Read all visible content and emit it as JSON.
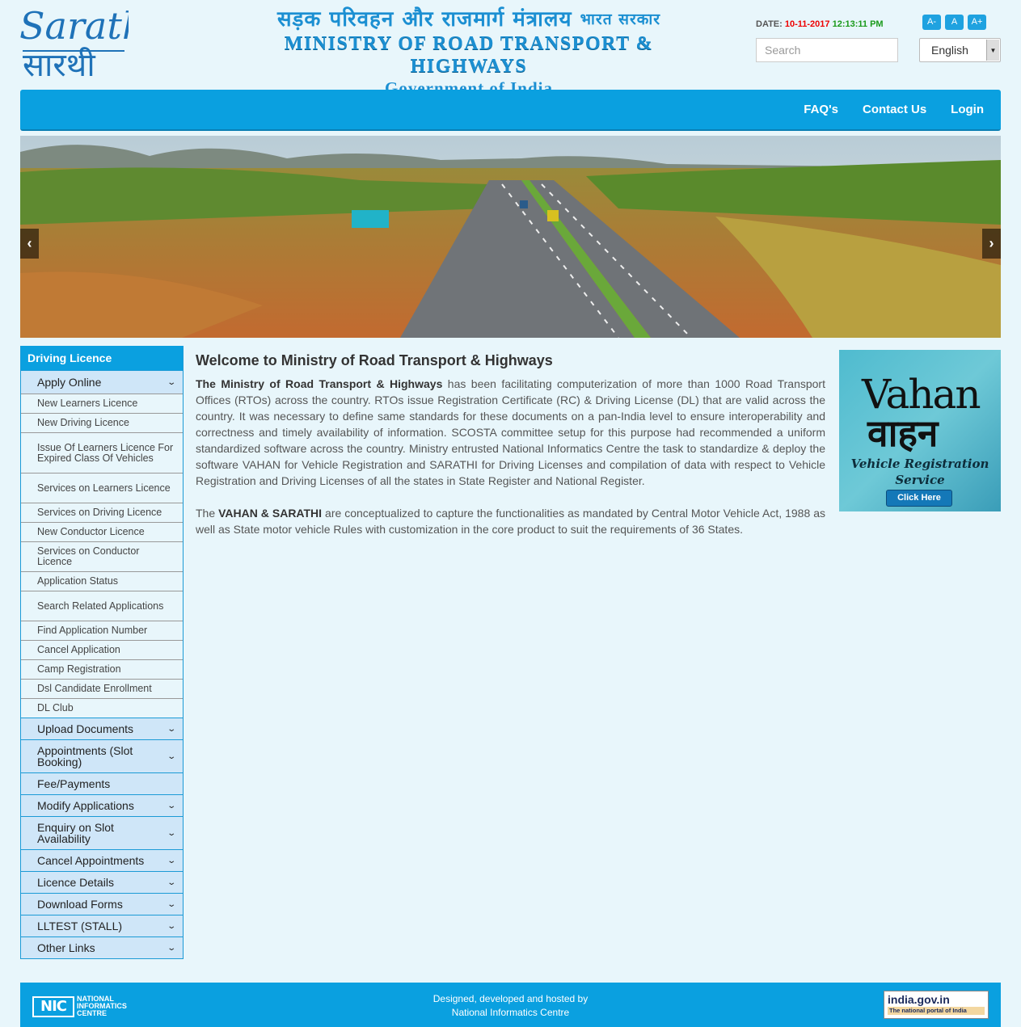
{
  "header": {
    "logo_en": "Sarathi",
    "logo_hi": "सारथी",
    "ministry_hindi": "सड़क परिवहन और राजमार्ग मंत्रालय",
    "gov_hindi": "भारत सरकार",
    "ministry_en": "MINISTRY OF ROAD TRANSPORT & HIGHWAYS",
    "gov_en": "Government of India",
    "date_label": "DATE:",
    "date": "10-11-2017",
    "time": "12:13:11 PM",
    "font_sizes": [
      "A-",
      "A",
      "A+"
    ],
    "search_placeholder": "Search",
    "language": "English"
  },
  "nav": {
    "items": [
      "FAQ's",
      "Contact Us",
      "Login"
    ]
  },
  "banner": {
    "prev": "‹",
    "next": "›"
  },
  "sidebar": {
    "title": "Driving Licence",
    "apply_online": "Apply Online",
    "sub_items": [
      "New Learners Licence",
      "New Driving Licence",
      "Issue Of Learners Licence For Expired Class Of Vehicles",
      "Services on Learners Licence",
      "Services on Driving Licence",
      "New Conductor Licence",
      "Services on Conductor Licence",
      "Application Status",
      "Search Related Applications",
      "Find Application Number",
      "Cancel Application",
      "Camp Registration",
      "Dsl Candidate Enrollment",
      "DL Club"
    ],
    "sections": [
      "Upload Documents",
      "Appointments (Slot Booking)",
      "Fee/Payments",
      "Modify Applications",
      "Enquiry on Slot Availability",
      "Cancel Appointments",
      "Licence Details",
      "Download Forms",
      "LLTEST (STALL)",
      "Other Links"
    ]
  },
  "main": {
    "title": "Welcome to Ministry of Road Transport & Highways",
    "p1_bold": "The Ministry of Road Transport & Highways",
    "p1_text": " has been facilitating computerization of more than 1000 Road Transport Offices (RTOs) across the country. RTOs issue Registration Certificate (RC) & Driving License (DL) that are valid across the country. It was necessary to define same standards for these documents on a pan-India level to ensure interoperability and correctness and timely availability of information. SCOSTA committee setup for this purpose had recommended a uniform standardized software across the country. Ministry entrusted National Informatics Centre the task to standardize & deploy the software VAHAN for Vehicle Registration and SARATHI for Driving Licenses and compilation of data with respect to Vehicle Registration and Driving Licenses of all the states in State Register and National Register.",
    "p2_pre": "The ",
    "p2_bold": "VAHAN & SARATHI",
    "p2_text": " are conceptualized to capture the functionalities as mandated by Central Motor Vehicle Act, 1988 as well as State motor vehicle Rules with customization in the core product to suit the requirements of 36 States."
  },
  "vahan_ad": {
    "title_en": "Vahan",
    "title_hi": "वाहन",
    "subtitle1": "Vehicle Registration",
    "subtitle2": "Service",
    "button": "Click Here"
  },
  "footer": {
    "nic_mark": "NIC",
    "nic_line1": "NATIONAL",
    "nic_line2": "INFORMATICS",
    "nic_line3": "CENTRE",
    "credit_line1": "Designed, developed and hosted by",
    "credit_line2": "National Informatics Centre",
    "indiagov_top": "india.gov.in",
    "indiagov_bottom": "The national portal of India"
  },
  "colors": {
    "primary": "#0aa0e0",
    "page_bg": "#e8f6fb",
    "sidebar_section_bg": "#cfe6f8",
    "date_color": "#e00000",
    "time_color": "#1a9a1a"
  }
}
